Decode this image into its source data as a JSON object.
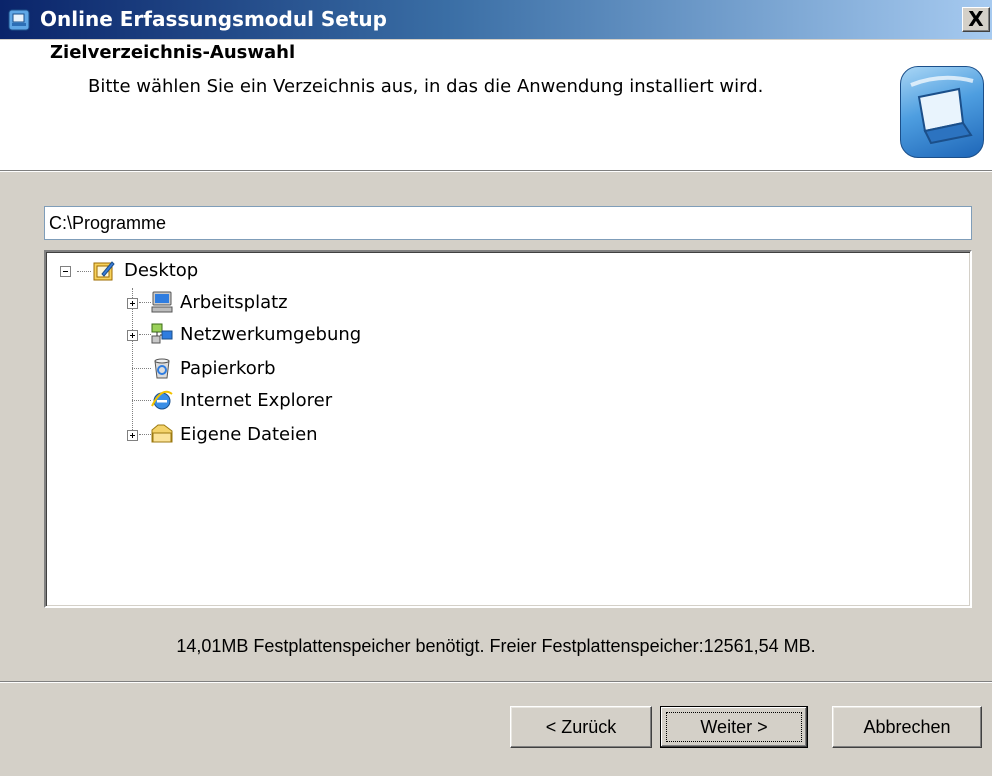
{
  "window": {
    "title": "Online Erfassungsmodul Setup",
    "close_label": "X"
  },
  "header": {
    "title": "Zielverzeichnis-Auswahl",
    "subtitle": "Bitte wählen Sie ein Verzeichnis aus, in das die Anwendung installiert wird."
  },
  "path": {
    "value": "C:\\Programme"
  },
  "tree": {
    "root": {
      "label": "Desktop",
      "icon": "desktop-icon"
    },
    "items": [
      {
        "label": "Arbeitsplatz",
        "icon": "computer-icon",
        "expandable": true
      },
      {
        "label": "Netzwerkumgebung",
        "icon": "network-icon",
        "expandable": true
      },
      {
        "label": "Papierkorb",
        "icon": "recycle-bin-icon",
        "expandable": false
      },
      {
        "label": "Internet Explorer",
        "icon": "internet-explorer-icon",
        "expandable": false
      },
      {
        "label": "Eigene Dateien",
        "icon": "folder-icon",
        "expandable": true
      }
    ]
  },
  "disk": {
    "info": "14,01MB Festplattenspeicher benötigt. Freier Festplattenspeicher:12561,54 MB."
  },
  "buttons": {
    "back": "< Zurück",
    "next": "Weiter >",
    "cancel": "Abbrechen"
  }
}
